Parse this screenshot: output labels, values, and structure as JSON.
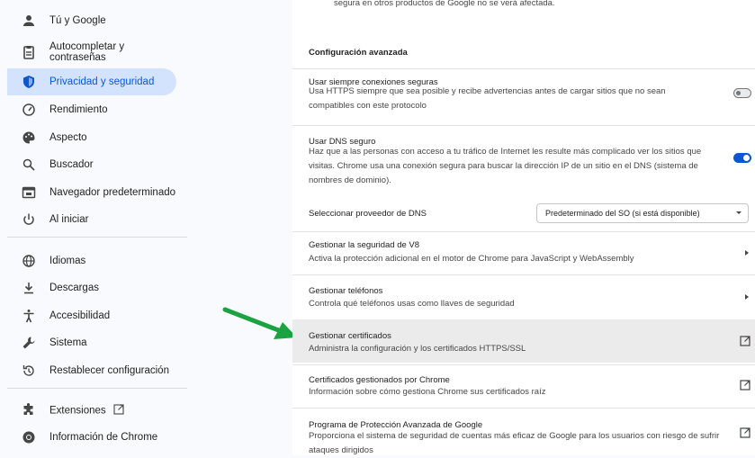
{
  "sidebar": {
    "items": [
      {
        "label": "Tú y Google",
        "icon": "person-icon"
      },
      {
        "label": "Autocompletar y contraseñas",
        "icon": "clipboard-icon"
      },
      {
        "label": "Privacidad y seguridad",
        "icon": "shield-icon"
      },
      {
        "label": "Rendimiento",
        "icon": "speedometer-icon"
      },
      {
        "label": "Aspecto",
        "icon": "palette-icon"
      },
      {
        "label": "Buscador",
        "icon": "search-icon"
      },
      {
        "label": "Navegador predeterminado",
        "icon": "browser-icon"
      },
      {
        "label": "Al iniciar",
        "icon": "power-icon"
      },
      {
        "label": "Idiomas",
        "icon": "globe-icon"
      },
      {
        "label": "Descargas",
        "icon": "download-icon"
      },
      {
        "label": "Accesibilidad",
        "icon": "accessibility-icon"
      },
      {
        "label": "Sistema",
        "icon": "wrench-icon"
      },
      {
        "label": "Restablecer configuración",
        "icon": "reset-icon"
      },
      {
        "label": "Extensiones",
        "icon": "puzzle-icon"
      },
      {
        "label": "Información de Chrome",
        "icon": "chrome-icon"
      }
    ],
    "active": "Privacidad y seguridad"
  },
  "content": {
    "top_text": "segura en otros productos de Google no se verá afectada.",
    "section_title": "Configuración avanzada",
    "https": {
      "title": "Usar siempre conexiones seguras",
      "desc": "Usa HTTPS siempre que sea posible y recibe advertencias antes de cargar sitios que no sean compatibles con este protocolo",
      "enabled": false
    },
    "dns": {
      "title": "Usar DNS seguro",
      "desc": "Haz que a las personas con acceso a tu tráfico de Internet les resulte más complicado ver los sitios que visitas. Chrome usa una conexión segura para buscar la dirección IP de un sitio en el DNS (sistema de nombres de dominio).",
      "enabled": true
    },
    "dns_provider": {
      "label": "Seleccionar proveedor de DNS",
      "value": "Predeterminado del SO (si está disponible)"
    },
    "v8": {
      "title": "Gestionar la seguridad de V8",
      "desc": "Activa la protección adicional en el motor de Chrome para JavaScript y WebAssembly"
    },
    "phones": {
      "title": "Gestionar teléfonos",
      "desc": "Controla qué teléfonos usas como llaves de seguridad"
    },
    "certs": {
      "title": "Gestionar certificados",
      "desc": "Administra la configuración y los certificados HTTPS/SSL"
    },
    "chrome_certs": {
      "title": "Certificados gestionados por Chrome",
      "desc": "Información sobre cómo gestiona Chrome sus certificados raíz"
    },
    "advanced_protection": {
      "title": "Programa de Protección Avanzada de Google",
      "desc": "Proporciona el sistema de seguridad de cuentas más eficaz de Google para los usuarios con riesgo de sufrir ataques dirigidos"
    }
  },
  "colors": {
    "accent": "#0b57d0",
    "active_bg": "#d3e3fd",
    "arrow": "#1aa340",
    "hover_row": "#ebebeb"
  }
}
